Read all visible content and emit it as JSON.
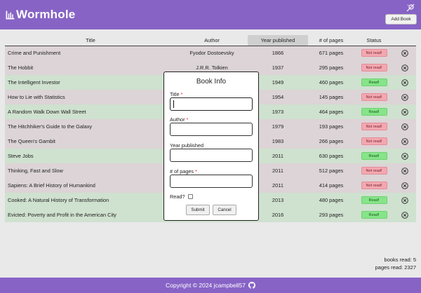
{
  "app": {
    "title": "Wormhole"
  },
  "header": {
    "add_book_label": "Add Book"
  },
  "table": {
    "columns": [
      "Title",
      "Author",
      "Year published",
      "# of pages",
      "Status"
    ],
    "rows": [
      {
        "title": "Crime and Punishment",
        "author": "Fyodor Dostoevsky",
        "year": "1866",
        "pages": "671 pages",
        "status": "Not read!",
        "read": false
      },
      {
        "title": "The Hobbit",
        "author": "J.R.R. Tolkien",
        "year": "1937",
        "pages": "295 pages",
        "status": "Not read!",
        "read": false
      },
      {
        "title": "The Intelligent Investor",
        "author": "",
        "year": "1949",
        "pages": "460 pages",
        "status": "Read!",
        "read": true
      },
      {
        "title": "How to Lie with Statistics",
        "author": "",
        "year": "1954",
        "pages": "145 pages",
        "status": "Not read!",
        "read": false
      },
      {
        "title": "A Random Walk Down Wall Street",
        "author": "",
        "year": "1973",
        "pages": "464 pages",
        "status": "Read!",
        "read": true
      },
      {
        "title": "The Hitchhiker's Guide to the Galaxy",
        "author": "",
        "year": "1979",
        "pages": "193 pages",
        "status": "Not read!",
        "read": false
      },
      {
        "title": "The Queen's Gambit",
        "author": "",
        "year": "1983",
        "pages": "266 pages",
        "status": "Not read!",
        "read": false
      },
      {
        "title": "Steve Jobs",
        "author": "",
        "year": "2011",
        "pages": "630 pages",
        "status": "Read!",
        "read": true
      },
      {
        "title": "Thinking, Fast and Slow",
        "author": "",
        "year": "2011",
        "pages": "512 pages",
        "status": "Not read!",
        "read": false
      },
      {
        "title": "Sapiens: A Brief History of Humankind",
        "author": "",
        "year": "2011",
        "pages": "414 pages",
        "status": "Not read!",
        "read": false
      },
      {
        "title": "Cooked: A Natural History of Transformation",
        "author": "",
        "year": "2013",
        "pages": "480 pages",
        "status": "Read!",
        "read": true
      },
      {
        "title": "Evicted: Poverty and Profit in the American City",
        "author": "",
        "year": "2016",
        "pages": "293 pages",
        "status": "Read!",
        "read": true
      }
    ]
  },
  "totals": {
    "books_read": "books read: 5",
    "pages_read": "pages read: 2327"
  },
  "modal": {
    "heading": "Book Info",
    "title_label": "Title",
    "author_label": "Author",
    "year_label": "Year published",
    "pages_label": "# of pages",
    "required_mark": "*",
    "read_label": "Read?",
    "submit_label": "Submit",
    "cancel_label": "Cancel"
  },
  "footer": {
    "text": "Copyright © 2024 jcampbell57"
  },
  "colors": {
    "brand": "#8763c6",
    "read_row": "#cfe1cf",
    "unread_row": "#dcd4d6",
    "read_badge": "#86e489",
    "not_read_badge": "#f2a8b1"
  }
}
